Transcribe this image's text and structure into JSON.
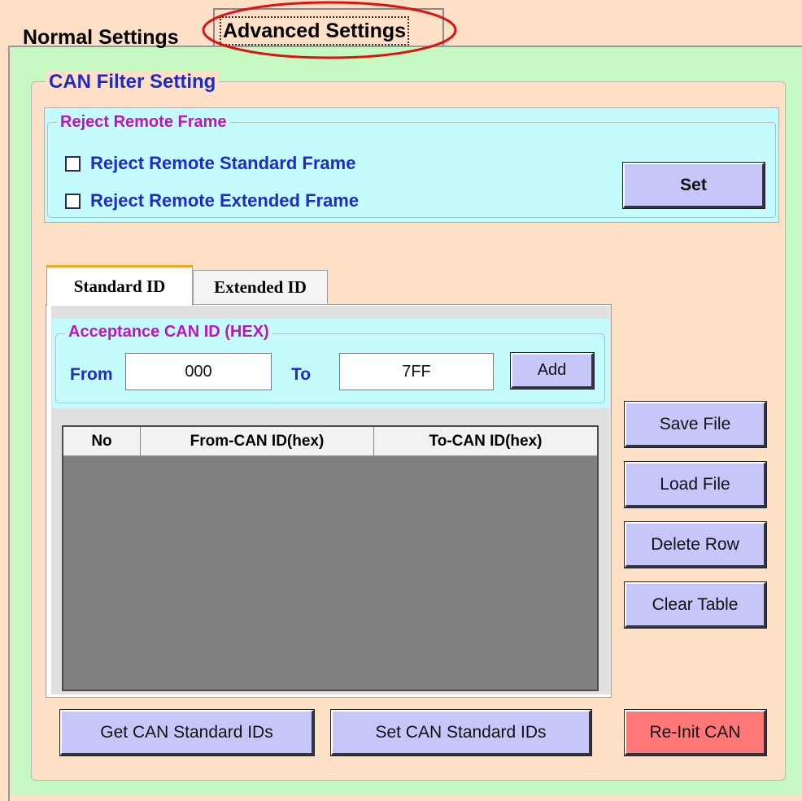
{
  "tabs": {
    "normal_label": "Normal Settings",
    "advanced_label": "Advanced Settings"
  },
  "can_filter": {
    "title": "CAN Filter Setting",
    "reject_remote_frame": {
      "title": "Reject Remote Frame",
      "standard_label": "Reject Remote Standard Frame",
      "extended_label": "Reject Remote Extended Frame",
      "standard_checked": false,
      "extended_checked": false,
      "set_label": "Set"
    },
    "id_tabs": {
      "standard_label": "Standard ID",
      "extended_label": "Extended ID"
    },
    "acceptance": {
      "title": "Acceptance CAN ID (HEX)",
      "from_label": "From",
      "from_value": "000",
      "to_label": "To",
      "to_value": "7FF",
      "add_label": "Add"
    },
    "table": {
      "columns": [
        "No",
        "From-CAN ID(hex)",
        "To-CAN ID(hex)"
      ],
      "rows": []
    },
    "side_buttons": {
      "save_file": "Save File",
      "load_file": "Load File",
      "delete_row": "Delete Row",
      "clear_table": "Clear Table"
    },
    "bottom_buttons": {
      "get_ids": "Get CAN Standard IDs",
      "set_ids": "Set CAN Standard IDs",
      "reinit": "Re-Init CAN"
    }
  },
  "colors": {
    "panel": "#fde0c5",
    "frame": "#c6f8c2",
    "group": "#c4fbfc",
    "button": "#c6c6f8",
    "reinit_button": "#ff7878",
    "title_blue": "#1f2bc9",
    "group_title_magenta": "#c312bd",
    "highlight_circle": "#e01010"
  }
}
